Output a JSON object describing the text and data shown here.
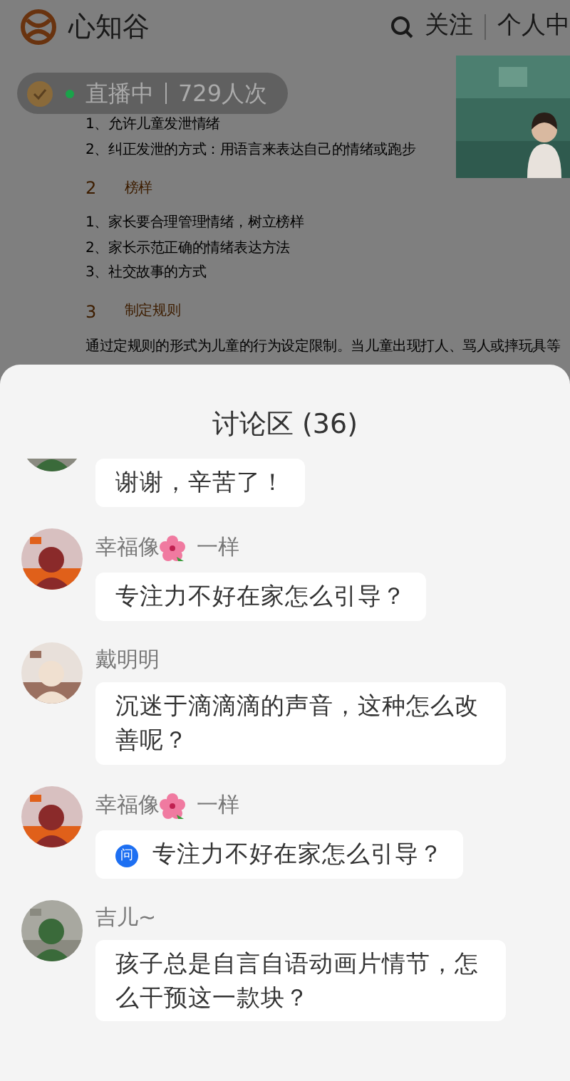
{
  "header": {
    "brand": "心知谷",
    "follow": "关注",
    "profile": "个人中"
  },
  "live": {
    "status": "直播中",
    "viewers": "729人次"
  },
  "article": [
    {
      "kind": "line",
      "text": "1、允许儿童发泄情绪"
    },
    {
      "kind": "line",
      "text": "2、纠正发泄的方式：用语言来表达自己的情绪或跑步"
    },
    {
      "kind": "heading",
      "number": "2",
      "title": "榜样"
    },
    {
      "kind": "line",
      "text": "1、家长要合理管理情绪，树立榜样"
    },
    {
      "kind": "line",
      "text": "2、家长示范正确的情绪表达方法"
    },
    {
      "kind": "line",
      "text": "3、社交故事的方式"
    },
    {
      "kind": "heading",
      "number": "3",
      "title": "制定规则"
    },
    {
      "kind": "line",
      "text": "通过定规则的形式为儿童的行为设定限制。当儿童出现打人、骂人或摔玩具等"
    }
  ],
  "discussion": {
    "title": "讨论区 (36)",
    "comments": [
      {
        "text": "谢谢，辛苦了！",
        "question": false
      },
      {
        "name": "幸福像",
        "has_flower": true,
        "name_suffix": "一样",
        "text": "专注力不好在家怎么引导？",
        "question": false
      },
      {
        "name": "戴明明",
        "has_flower": false,
        "text": "沉迷于滴滴滴的声音，这种怎么改善呢？",
        "question": false
      },
      {
        "name": "幸福像",
        "has_flower": true,
        "name_suffix": "一样",
        "text": "专注力不好在家怎么引导？",
        "question": true,
        "question_label": "问"
      },
      {
        "name": "吉儿~",
        "has_flower": false,
        "text": "孩子总是自言自语动画片情节，怎么干预这一款块？",
        "question": false
      }
    ]
  }
}
